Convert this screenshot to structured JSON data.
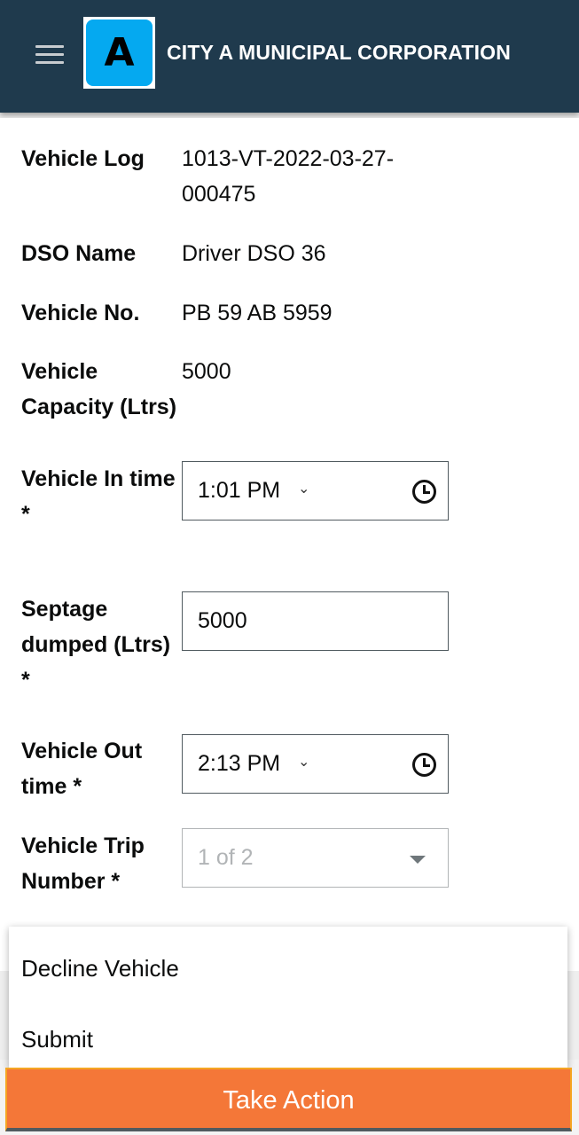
{
  "header": {
    "logo_letter": "A",
    "title": "CITY A MUNICIPAL CORPORATION"
  },
  "details": {
    "vehicle_log_label": "Vehicle Log",
    "vehicle_log_line1": "1013-VT-2022-03-27-",
    "vehicle_log_line2": "000475",
    "dso_name_label": "DSO Name",
    "dso_name_value": "Driver DSO 36",
    "vehicle_no_label": "Vehicle No.",
    "vehicle_no_value": "PB 59 AB 5959",
    "capacity_label_line1": "Vehicle",
    "capacity_label_line2": "Capacity (Ltrs)",
    "capacity_value": "5000"
  },
  "form": {
    "in_time_label_line1": "Vehicle In time",
    "in_time_label_line2": "*",
    "in_time_value": "1:01  PM",
    "septage_label_line1": "Septage",
    "septage_label_line2": "dumped (Ltrs)",
    "septage_label_line3": "*",
    "septage_value": "5000",
    "out_time_label_line1": "Vehicle Out",
    "out_time_label_line2": "time *",
    "out_time_value": "2:13  PM",
    "trip_label_line1": "Vehicle Trip",
    "trip_label_line2": "Number *",
    "trip_value": "1 of 2"
  },
  "action_menu": {
    "items": [
      "Decline Vehicle",
      "Submit"
    ]
  },
  "footer": {
    "take_action_label": "Take Action"
  },
  "colors": {
    "header_bg": "#1f3a4d",
    "logo_bg": "#05a9f0",
    "action_button": "#f47738"
  }
}
